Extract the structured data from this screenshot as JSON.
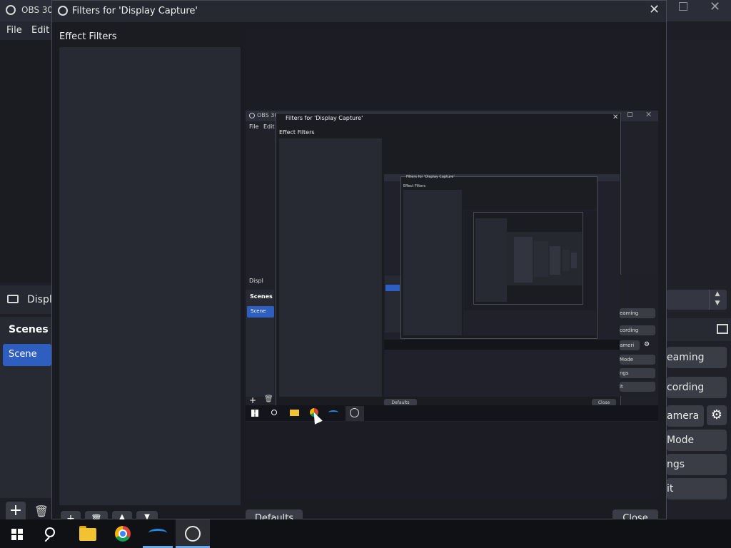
{
  "obs": {
    "title": "OBS 30.",
    "menu": {
      "file": "File",
      "edit": "Edit"
    },
    "source_label": "Displa",
    "scenes_title": "Scenes",
    "scene_name": "Scene",
    "add_symbol": "+",
    "delete_symbol": "🗑"
  },
  "controls": {
    "streaming": "eaming",
    "recording": "cording",
    "camera": "amera",
    "studio_mode": "Mode",
    "settings": "ngs",
    "exit": "it",
    "gear_symbol": "⚙",
    "spinner_up": "▲",
    "spinner_down": "▼"
  },
  "filters_dialog": {
    "title": "Filters for 'Display Capture'",
    "close_symbol": "✕",
    "effect_filters": "Effect Filters",
    "add_symbol": "+",
    "delete_symbol": "🗑",
    "up_symbol": "▲",
    "down_symbol": "▼",
    "defaults_label": "Defaults",
    "close_label": "Close"
  },
  "nested": {
    "obs_title": "OBS 30.",
    "dialog_title": "Filters for 'Display Capture'",
    "file": "File",
    "edit": "Edit",
    "effect_filters": "Effect Filters",
    "source": "Displ",
    "scenes": "Scenes",
    "scene": "Scene",
    "defaults": "Defaults",
    "close": "Close",
    "controls": [
      "eaming",
      "cording",
      "ameri",
      "Mode",
      "ngs",
      "it"
    ],
    "nested2_title": "Filters for 'Display Capture'",
    "nested2_effect": "Effect Filters"
  },
  "taskbar": {
    "items": [
      "start",
      "search",
      "file-explorer",
      "chrome",
      "dolphin",
      "obs"
    ]
  }
}
